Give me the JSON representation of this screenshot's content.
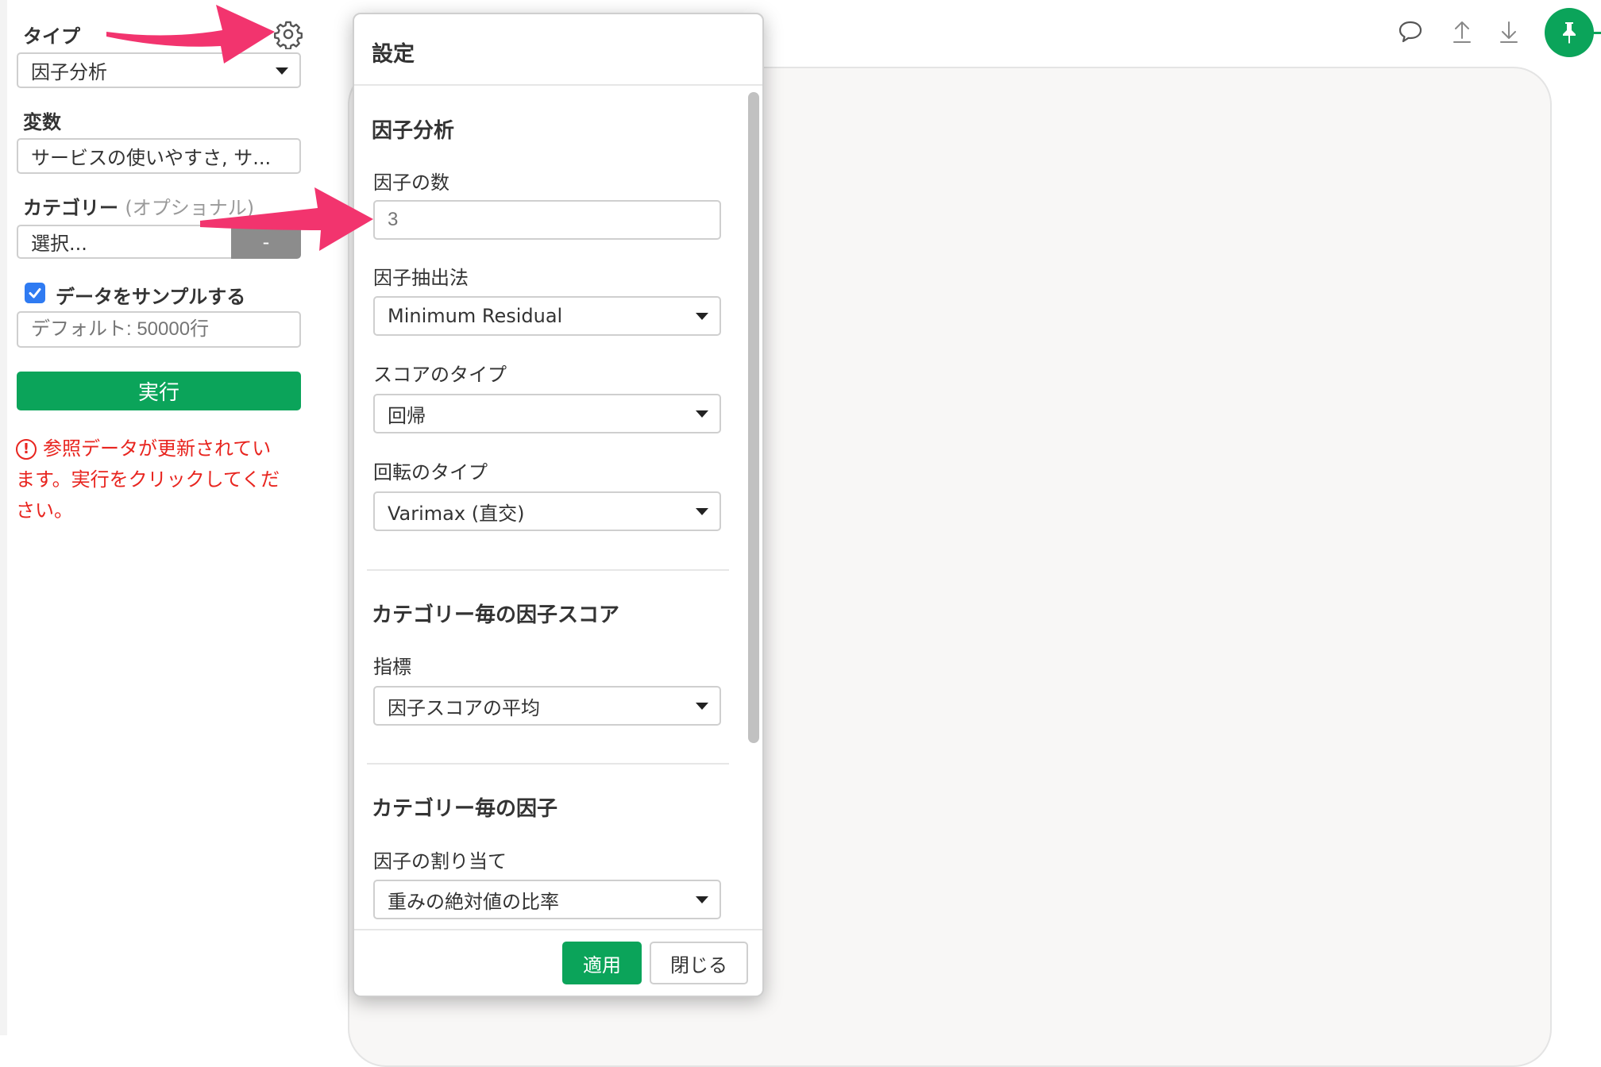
{
  "sidebar": {
    "type_label": "タイプ",
    "type_value": "因子分析",
    "variables_label": "変数",
    "variables_value": "サービスの使いやすさ, サ...",
    "category_label": "カテゴリー",
    "category_optional": "(オプショナル)",
    "category_value": "選択...",
    "category_clear": "-",
    "sample_checked": true,
    "sample_label": "データをサンプルする",
    "sample_placeholder": "デフォルト: 50000行",
    "run_label": "実行",
    "warning_lines": [
      "参照データが更新されてい",
      "ます。実行をクリックしてくだ",
      "さい。"
    ]
  },
  "dialog": {
    "title": "設定",
    "section_factor": "因子分析",
    "num_factors_label": "因子の数",
    "num_factors_placeholder": "3",
    "extraction_label": "因子抽出法",
    "extraction_value": "Minimum Residual",
    "score_type_label": "スコアのタイプ",
    "score_type_value": "回帰",
    "rotation_label": "回転のタイプ",
    "rotation_value": "Varimax (直交)",
    "section_category_score": "カテゴリー毎の因子スコア",
    "metric_label": "指標",
    "metric_value": "因子スコアの平均",
    "section_category_factor": "カテゴリー毎の因子",
    "assignment_label": "因子の割り当て",
    "assignment_value": "重みの絶対値の比率",
    "apply_label": "適用",
    "close_label": "閉じる"
  },
  "toolbar": {
    "icons": [
      "comment-icon",
      "upload-icon",
      "download-icon",
      "pin-icon"
    ]
  },
  "colors": {
    "accent_green": "#0ba45a",
    "warning_red": "#e8251f",
    "annotation_arrow": "#f2346e",
    "checkbox_blue": "#2f7bf2"
  }
}
